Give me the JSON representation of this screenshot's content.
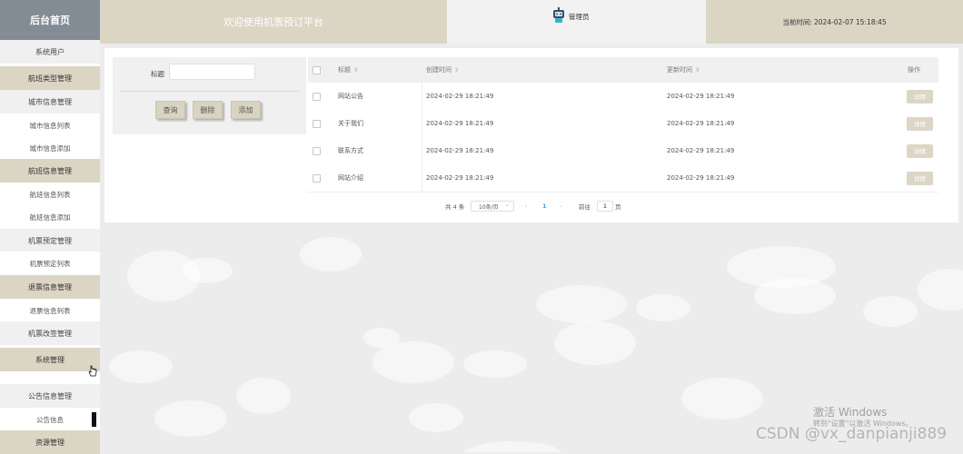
{
  "sidebar": {
    "logo": "后台首页",
    "items": [
      {
        "label": "系统用户",
        "type": "light"
      },
      {
        "label": "航班类型管理",
        "type": "group"
      },
      {
        "label": "城市信息管理",
        "type": "light"
      },
      {
        "label": "城市信息列表",
        "type": "sub"
      },
      {
        "label": "城市信息添加",
        "type": "sub"
      },
      {
        "label": "航班信息管理",
        "type": "group"
      },
      {
        "label": "航班信息列表",
        "type": "sub"
      },
      {
        "label": "航班信息添加",
        "type": "sub"
      },
      {
        "label": "机票预定管理",
        "type": "light"
      },
      {
        "label": "机票预定列表",
        "type": "sub"
      },
      {
        "label": "退票信息管理",
        "type": "group"
      },
      {
        "label": "退票信息列表",
        "type": "sub"
      },
      {
        "label": "机票改签管理",
        "type": "light"
      },
      {
        "label": "系统管理",
        "type": "group"
      },
      {
        "label": "公告信息管理",
        "type": "light"
      },
      {
        "label": "公告信息",
        "type": "sub",
        "active": true
      },
      {
        "label": "资源管理",
        "type": "group"
      }
    ]
  },
  "header": {
    "title": "欢迎使用机票预订平台",
    "user": "管理员",
    "time_label": "当前时间:",
    "time_value": "2024-02-07 15:18:45"
  },
  "search": {
    "label": "标题",
    "value": "",
    "query_button": "查询",
    "delete_button": "删除",
    "add_button": "添加"
  },
  "table": {
    "columns": {
      "title": "标题",
      "created": "创建时间",
      "updated": "更新时间",
      "action": "操作"
    },
    "rows": [
      {
        "title": "网站公告",
        "created": "2024-02-29 18:21:49",
        "updated": "2024-02-29 18:21:49",
        "action": "详情"
      },
      {
        "title": "关于我们",
        "created": "2024-02-29 18:21:49",
        "updated": "2024-02-29 18:21:49",
        "action": "详情"
      },
      {
        "title": "联系方式",
        "created": "2024-02-29 18:21:49",
        "updated": "2024-02-29 18:21:49",
        "action": "详情"
      },
      {
        "title": "网站介绍",
        "created": "2024-02-29 18:21:49",
        "updated": "2024-02-29 18:21:49",
        "action": "详情"
      }
    ]
  },
  "pagination": {
    "total": "共 4 条",
    "page_size": "10条/页",
    "current_page": "1",
    "prev_icon": "chevron-left-icon",
    "next_icon": "chevron-right-icon",
    "goto_label": "前往",
    "goto_value": "1",
    "page_unit": "页"
  },
  "watermark": {
    "activate_title": "激活 Windows",
    "activate_hint": "转到\"设置\"以激活 Windows。",
    "csdn": "CSDN @vx_danpianji889"
  },
  "colors": {
    "accent": "#dbd5c4",
    "logo_bg": "#838b95",
    "pager_active": "#409eff"
  }
}
